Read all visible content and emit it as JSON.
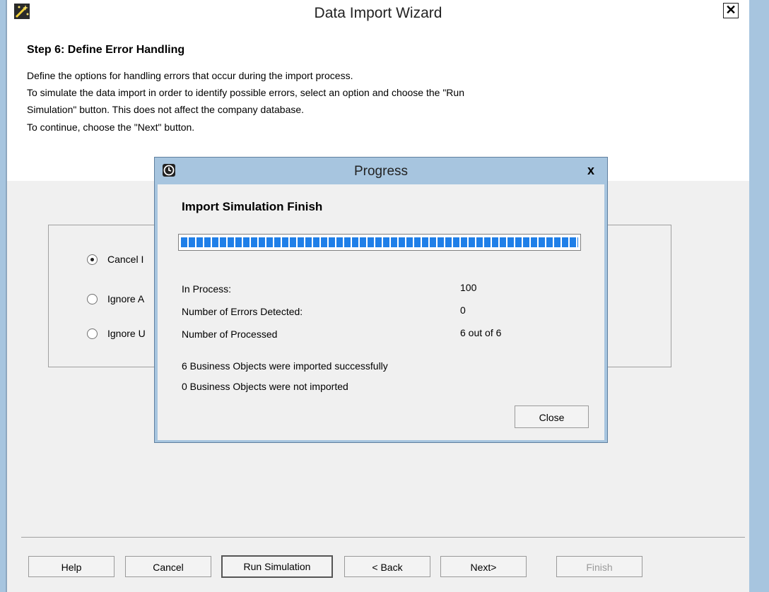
{
  "window": {
    "title": "Data Import Wizard",
    "close_glyph": "✕"
  },
  "step": {
    "title": "Step 6: Define Error Handling",
    "description_lines": [
      "Define the options for handling errors that occur during the import process.",
      "To simulate the data import in order to identify possible errors, select an option and choose the \"Run",
      "Simulation\" button. This does not affect the company database.",
      "To continue, choose the \"Next\" button."
    ]
  },
  "options": [
    {
      "label": "Cancel I",
      "selected": true
    },
    {
      "label": "Ignore A",
      "selected": false
    },
    {
      "label": "Ignore U",
      "selected": false
    }
  ],
  "buttons": {
    "help": "Help",
    "cancel": "Cancel",
    "run_simulation": "Run Simulation",
    "back": "< Back",
    "next": "Next>",
    "finish": "Finish"
  },
  "progress_dialog": {
    "title": "Progress",
    "close_glyph": "x",
    "heading": "Import Simulation Finish",
    "progress_fraction": 1.0,
    "stats": [
      {
        "label": "In Process:",
        "value": "100"
      },
      {
        "label": "Number of Errors Detected:",
        "value": "0"
      },
      {
        "label": "Number of Processed",
        "value": "6 out of 6"
      }
    ],
    "messages": [
      "6 Business Objects were imported successfully",
      "0 Business Objects were not imported"
    ],
    "close_button": "Close"
  },
  "icons": {
    "wizard": "magic-wand-icon",
    "progress": "clock-icon"
  },
  "colors": {
    "frame": "#a7c5df",
    "progress_fill": "#1f7fe8"
  }
}
